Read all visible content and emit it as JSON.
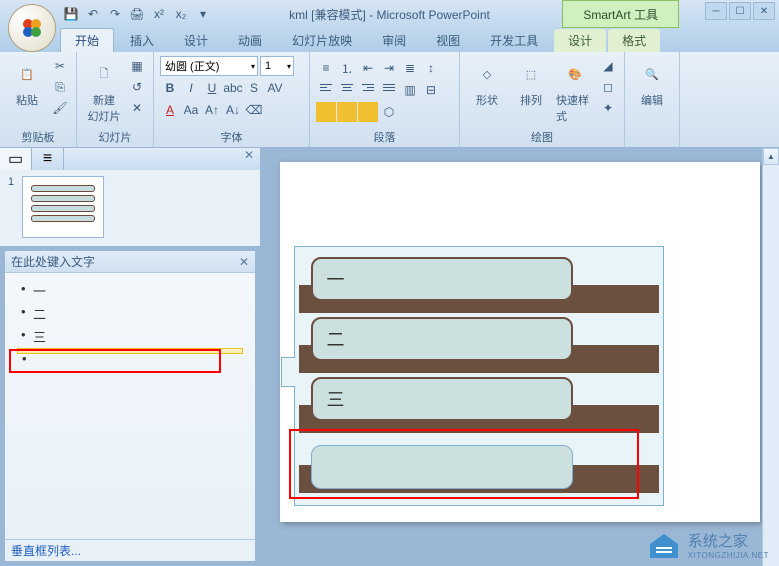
{
  "app": {
    "title": "kml [兼容模式] - Microsoft PowerPoint",
    "context_tool": "SmartArt 工具"
  },
  "qat": [
    "save-icon",
    "undo-icon",
    "redo-icon",
    "print-icon",
    "superscript-icon",
    "subscript-icon"
  ],
  "tabs": {
    "items": [
      "开始",
      "插入",
      "设计",
      "动画",
      "幻灯片放映",
      "审阅",
      "视图",
      "开发工具"
    ],
    "context_items": [
      "设计",
      "格式"
    ],
    "active": "开始"
  },
  "ribbon": {
    "clipboard": {
      "label": "剪贴板",
      "paste": "粘贴"
    },
    "slides": {
      "label": "幻灯片",
      "new": "新建\n幻灯片"
    },
    "font": {
      "label": "字体",
      "family": "幼圆 (正文)",
      "size": "1"
    },
    "paragraph": {
      "label": "段落"
    },
    "drawing": {
      "label": "绘图",
      "shapes": "形状",
      "arrange": "排列",
      "quick": "快速样式"
    },
    "editing": {
      "label": "编辑"
    }
  },
  "text_pane": {
    "title": "在此处键入文字",
    "items": [
      "一",
      "二",
      "三",
      ""
    ],
    "footer": "垂直框列表..."
  },
  "smartart": {
    "shapes": [
      "一",
      "二",
      "三",
      ""
    ]
  },
  "thumbnail": {
    "number": "1"
  },
  "watermark": {
    "name": "系统之家",
    "url": "XITONGZHIJIA.NET"
  }
}
